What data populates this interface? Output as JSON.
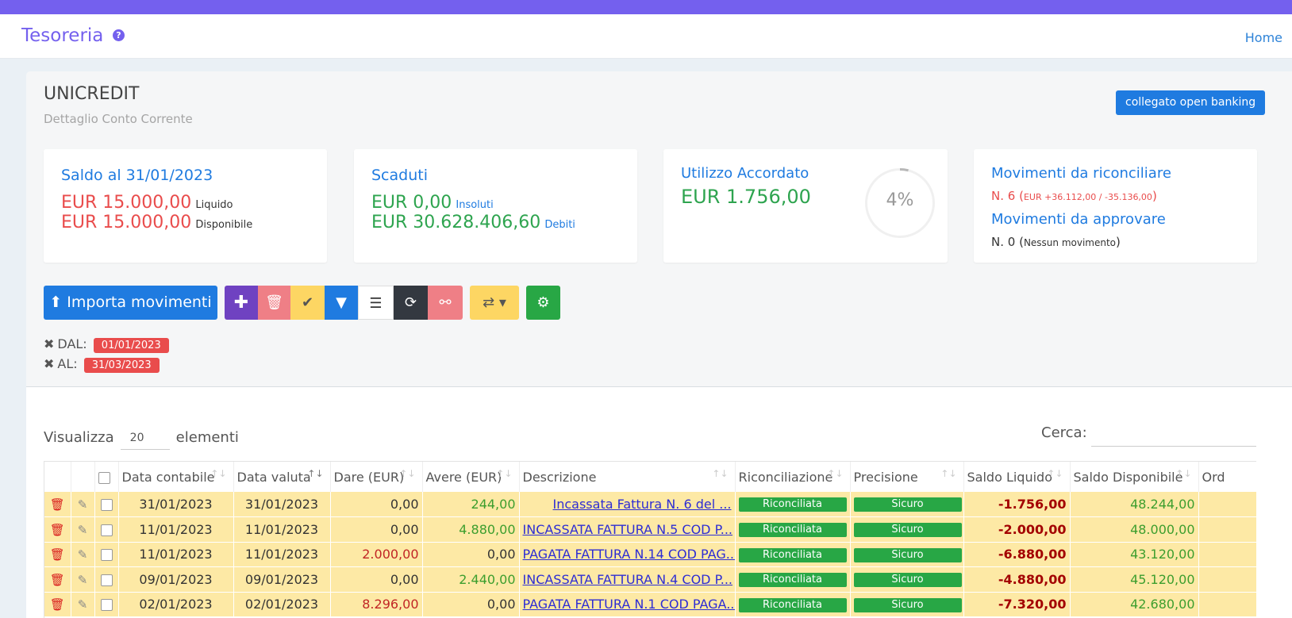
{
  "app": {
    "title": "Tesoreria",
    "home_link": "Home"
  },
  "account": {
    "name": "UNICREDIT",
    "subtitle": "Dettaglio Conto Corrente",
    "open_banking_badge": "collegato open banking"
  },
  "cards": {
    "saldo": {
      "title": "Saldo al 31/01/2023",
      "liquido_amount": "EUR 15.000,00",
      "liquido_label": "Liquido",
      "disponibile_amount": "EUR 15.000,00",
      "disponibile_label": "Disponibile"
    },
    "scaduti": {
      "title": "Scaduti",
      "insoluti_amount": "EUR 0,00",
      "insoluti_label": "Insoluti",
      "debiti_amount": "EUR 30.628.406,60",
      "debiti_label": "Debiti"
    },
    "utilizzo": {
      "title": "Utilizzo Accordato",
      "amount": "EUR 1.756,00",
      "percent_label": "4%",
      "percent_value": 0.04
    },
    "movimenti": {
      "riconciliare_title": "Movimenti da riconciliare",
      "riconciliare_count": "N. 6",
      "riconciliare_detail": "EUR +36.112,00 / -35.136,00",
      "approvare_title": "Movimenti da approvare",
      "approvare_count": "N. 0",
      "approvare_detail": "Nessun movimento"
    }
  },
  "toolbar": {
    "import_label": "Importa movimenti",
    "icons": [
      "plus-icon",
      "trash-icon",
      "check-icon",
      "filter-icon",
      "list-icon",
      "refresh-icon",
      "unlink-icon",
      "retweet-icon",
      "gear-icon"
    ]
  },
  "filters": {
    "dal_label": "DAL:",
    "dal_value": "01/01/2023",
    "al_label": "AL:",
    "al_value": "31/03/2023"
  },
  "list_controls": {
    "show_label": "Visualizza",
    "show_value": "20",
    "elements_label": "elementi",
    "search_label": "Cerca:",
    "search_value": ""
  },
  "table": {
    "headers": [
      "Data contabile",
      "Data valuta",
      "Dare (EUR)",
      "Avere (EUR)",
      "Descrizione",
      "Riconciliazione",
      "Precisione",
      "Saldo Liquido",
      "Saldo Disponibile",
      "Ord"
    ],
    "rows": [
      {
        "data_contabile": "31/01/2023",
        "data_valuta": "31/01/2023",
        "dare": "0,00",
        "avere": "244,00",
        "descrizione": "Incassata Fattura N. 6 del ...",
        "riconciliazione": "Riconciliata",
        "precisione": "Sicuro",
        "saldo_liquido": "-1.756,00",
        "saldo_disponibile": "48.244,00"
      },
      {
        "data_contabile": "11/01/2023",
        "data_valuta": "11/01/2023",
        "dare": "0,00",
        "avere": "4.880,00",
        "descrizione": "INCASSATA FATTURA N.5 COD P...",
        "riconciliazione": "Riconciliata",
        "precisione": "Sicuro",
        "saldo_liquido": "-2.000,00",
        "saldo_disponibile": "48.000,00"
      },
      {
        "data_contabile": "11/01/2023",
        "data_valuta": "11/01/2023",
        "dare": "2.000,00",
        "avere": "0,00",
        "descrizione": "PAGATA FATTURA N.14 COD PAG...",
        "riconciliazione": "Riconciliata",
        "precisione": "Sicuro",
        "saldo_liquido": "-6.880,00",
        "saldo_disponibile": "43.120,00"
      },
      {
        "data_contabile": "09/01/2023",
        "data_valuta": "09/01/2023",
        "dare": "0,00",
        "avere": "2.440,00",
        "descrizione": "INCASSATA FATTURA N.4 COD P...",
        "riconciliazione": "Riconciliata",
        "precisione": "Sicuro",
        "saldo_liquido": "-4.880,00",
        "saldo_disponibile": "45.120,00"
      },
      {
        "data_contabile": "02/01/2023",
        "data_valuta": "02/01/2023",
        "dare": "8.296,00",
        "avere": "0,00",
        "descrizione": "PAGATA FATTURA N.1 COD PAGA...",
        "riconciliazione": "Riconciliata",
        "precisione": "Sicuro",
        "saldo_liquido": "-7.320,00",
        "saldo_disponibile": "42.680,00"
      }
    ]
  },
  "colors": {
    "brand": "#7460ee",
    "primary": "#1f7be0",
    "danger": "#e94c4c",
    "success": "#28a745",
    "warning": "#fdd663",
    "row_bg": "#fde9a5"
  }
}
